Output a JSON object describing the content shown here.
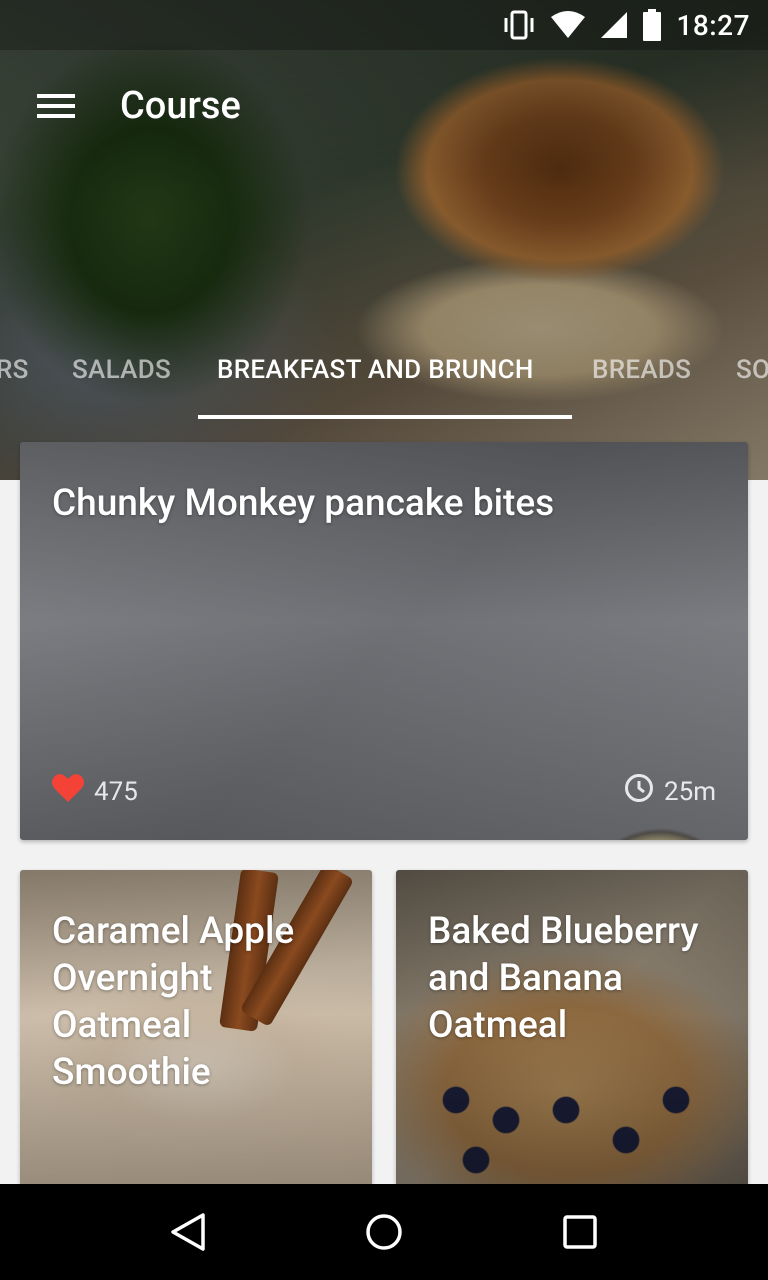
{
  "status_bar": {
    "time": "18:27",
    "icons": [
      "vibrate-icon",
      "wifi-icon",
      "signal-icon",
      "battery-icon"
    ]
  },
  "toolbar": {
    "title": "Course",
    "menu_icon": "hamburger-menu-icon"
  },
  "tabs": {
    "items": [
      {
        "label": "RS",
        "active": false
      },
      {
        "label": "SALADS",
        "active": false
      },
      {
        "label": "BREAKFAST AND BRUNCH",
        "active": true
      },
      {
        "label": "BREADS",
        "active": false
      },
      {
        "label": "SO",
        "active": false
      }
    ]
  },
  "recipes": {
    "featured": {
      "title": "Chunky Monkey pancake bites",
      "likes": "475",
      "time": "25m",
      "like_icon": "heart-icon",
      "time_icon": "clock-icon"
    },
    "cards": [
      {
        "title": "Caramel Apple Overnight Oatmeal Smoothie"
      },
      {
        "title": "Baked Blueberry and Banana Oatmeal"
      }
    ]
  },
  "colors": {
    "heart": "#f44336",
    "tab_indicator": "#ffffff",
    "nav_background": "#000000",
    "page_background": "#f2f2f2"
  },
  "nav_bar": {
    "buttons": [
      "back-icon",
      "home-icon",
      "recents-icon"
    ]
  }
}
